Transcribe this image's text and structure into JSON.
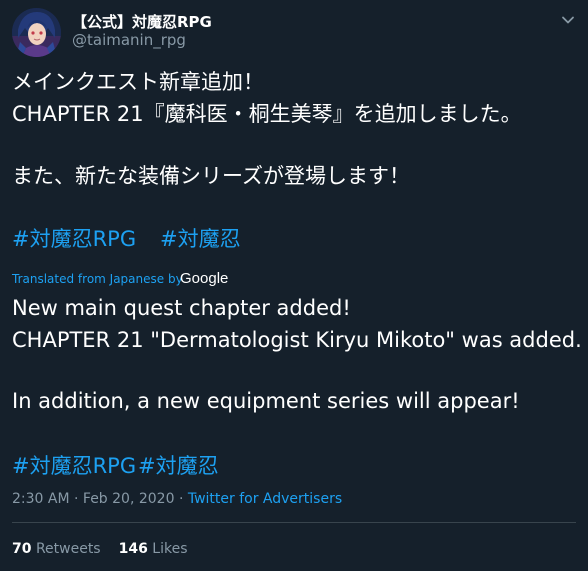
{
  "author": {
    "display_name": "【公式】対魔忍RPG",
    "handle": "@taimanin_rpg"
  },
  "tweet": {
    "jp_line1": "メインクエスト新章追加！",
    "jp_line2": "CHAPTER 21『魔科医・桐生美琴』を追加しました。",
    "jp_line3": "また、新たな装備シリーズが登場します！",
    "jp_hashtags": [
      "#対魔忍RPG",
      "#対魔忍"
    ],
    "translated_label": "Translated from Japanese by",
    "translator": "Google",
    "en_line1": "New main quest chapter added!",
    "en_line2": " CHAPTER 21 \"Dermatologist Kiryu Mikoto\" was added.",
    "en_line3": " In addition, a new equipment series will appear!",
    "en_hashtags": [
      "#対魔忍RPG",
      "#対魔忍"
    ],
    "time": "2:30 AM",
    "date": "Feb 20, 2020",
    "separator": "·",
    "source": "Twitter for Advertisers"
  },
  "stats": {
    "retweets_count": "70",
    "retweets_label": "Retweets",
    "likes_count": "146",
    "likes_label": "Likes"
  },
  "colors": {
    "background": "#15202b",
    "text": "#ffffff",
    "secondary": "#8899a6",
    "link": "#1da1f2",
    "divider": "#38444d"
  },
  "icons": {
    "caret": "chevron-down-icon",
    "avatar": "avatar"
  }
}
